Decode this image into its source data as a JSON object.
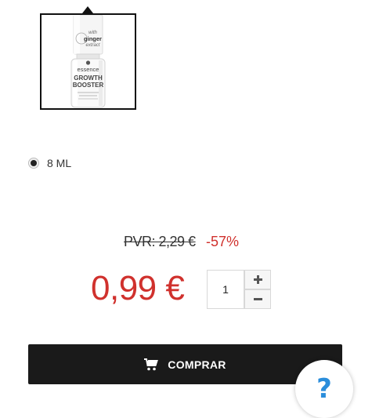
{
  "product_thumbnail": {
    "icon": "nail-polish-bottle-image",
    "label_with": "with",
    "label_ginger": "ginger",
    "label_extract": "extract",
    "brand": "essence",
    "name_line1": "GROWTH",
    "name_line2": "BOOSTER"
  },
  "variant": {
    "selected": true,
    "label": "8 ML"
  },
  "pricing": {
    "old_price": "PVR: 2,29 €",
    "discount": "-57%",
    "price": "0,99 €",
    "price_color": "#d0312d"
  },
  "quantity": {
    "value": "1",
    "increment_icon": "plus-icon",
    "decrement_icon": "minus-icon"
  },
  "buy_button": {
    "icon": "cart-icon",
    "label": "COMPRAR"
  },
  "help": {
    "icon": "question-mark-icon",
    "symbol": "?",
    "color": "#2a8ddb"
  }
}
